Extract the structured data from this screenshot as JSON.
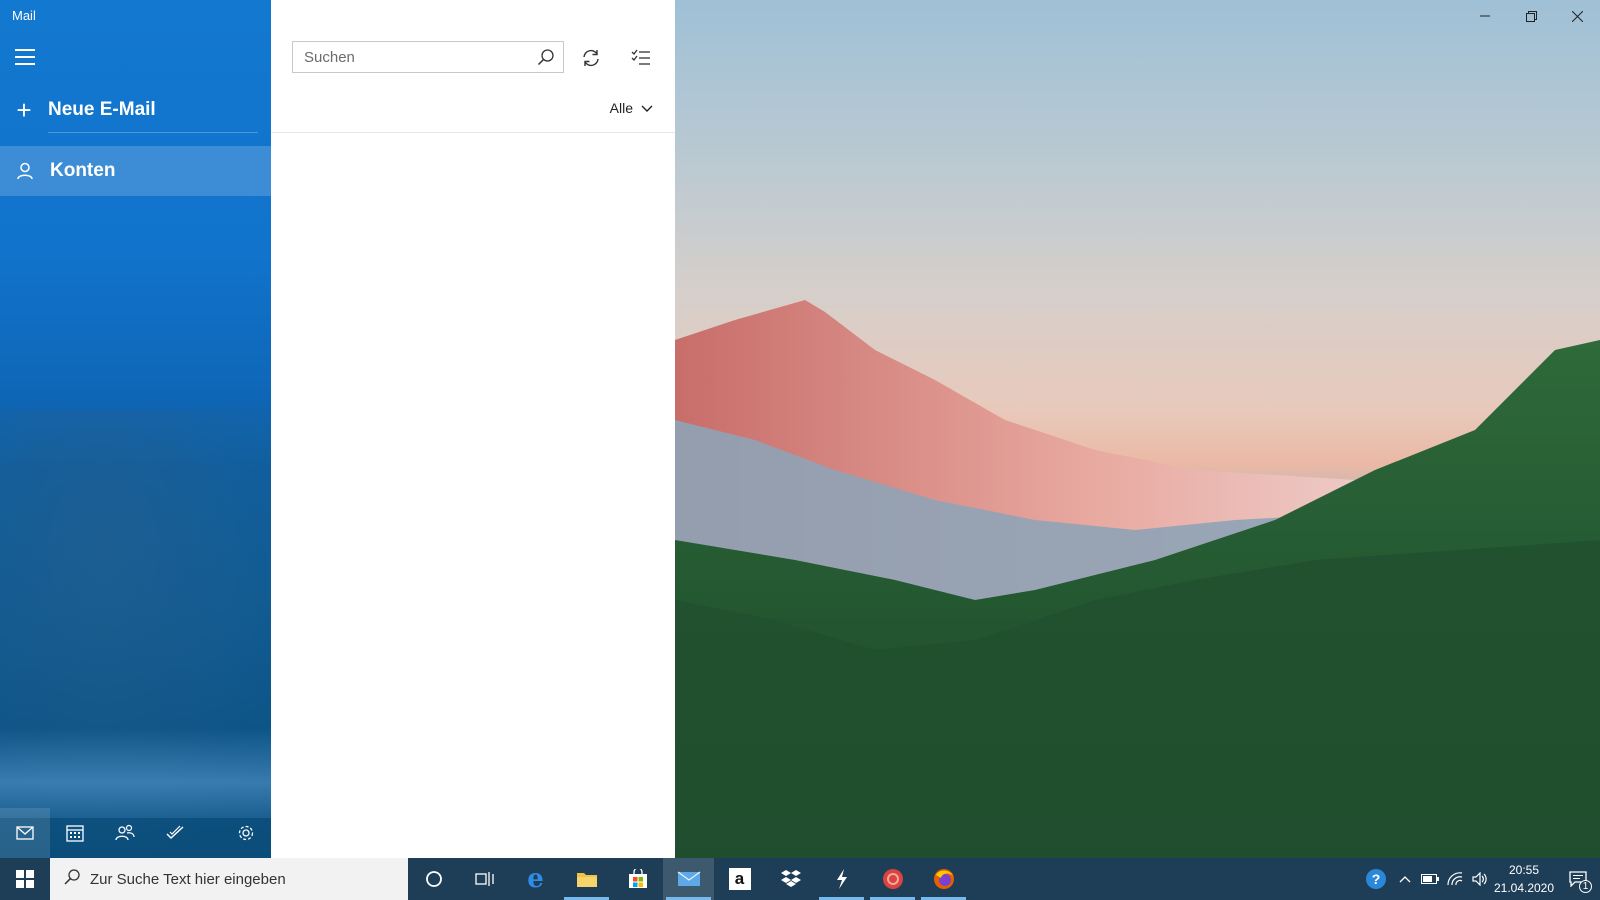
{
  "window": {
    "app_title": "Mail",
    "controls": [
      "minimize",
      "restore",
      "close"
    ]
  },
  "nav": {
    "menu_icon": "hamburger-icon",
    "new_mail_label": "Neue E-Mail",
    "accounts_label": "Konten",
    "bottom_icons": [
      "mail-icon",
      "calendar-icon",
      "people-icon",
      "todo-icon",
      "settings-icon"
    ]
  },
  "list": {
    "search_placeholder": "Suchen",
    "filter_label": "Alle"
  },
  "taskbar": {
    "search_placeholder": "Zur Suche Text hier eingeben",
    "apps": [
      "cortana-icon",
      "task-view-icon",
      "edge-icon",
      "file-explorer-icon",
      "store-icon",
      "mail-app-icon",
      "amazon-icon",
      "dropbox-icon",
      "app-bolt-icon",
      "app-red-icon",
      "firefox-icon"
    ],
    "time": "20:55",
    "date": "21.04.2020",
    "notification_count": "1"
  },
  "colors": {
    "nav_blue": "#1173cb",
    "taskbar": "#1e3e57",
    "active_indicator": "#76b9ed"
  }
}
